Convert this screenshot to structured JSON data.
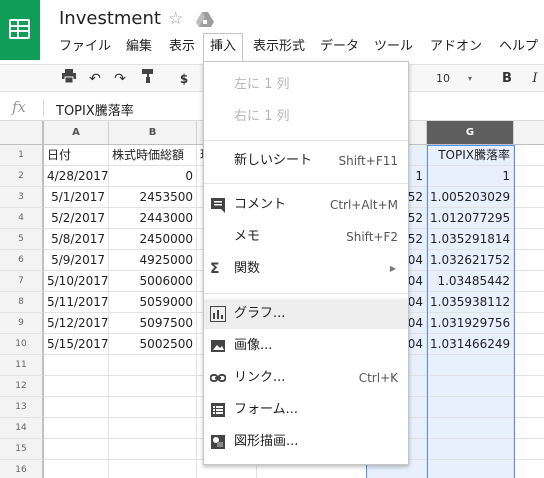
{
  "app": {
    "title": "Investment",
    "star_icon": "star-outline-icon",
    "drive_icon": "drive-icon"
  },
  "menubar": [
    {
      "label": "ファイル"
    },
    {
      "label": "編集"
    },
    {
      "label": "表示"
    },
    {
      "label": "挿入",
      "active": true
    },
    {
      "label": "表示形式"
    },
    {
      "label": "データ"
    },
    {
      "label": "ツール"
    },
    {
      "label": "アドオン"
    },
    {
      "label": "ヘルプ"
    }
  ],
  "toolbar": {
    "currency": "$",
    "font_size": "10",
    "bold": "B"
  },
  "formula": {
    "fx": "fx",
    "content": "TOPIX騰落率"
  },
  "grid": {
    "columns": [
      "A",
      "B",
      "",
      "",
      "",
      "",
      "G"
    ],
    "selected_column": "G",
    "row_numbers": [
      "1",
      "2",
      "3",
      "4",
      "5",
      "6",
      "7",
      "8",
      "9",
      "10",
      "11",
      "12",
      "13",
      "14",
      "15",
      "16"
    ],
    "col_a": [
      "日付",
      "4/28/2017",
      "5/1/2017",
      "5/2/2017",
      "5/8/2017",
      "5/9/2017",
      "5/10/2017",
      "5/11/2017",
      "5/12/2017",
      "5/15/2017"
    ],
    "col_b": [
      "株式時価総額",
      "0",
      "2453500",
      "2443000",
      "2450000",
      "4925000",
      "5006000",
      "5059000",
      "5097500",
      "5002500"
    ],
    "col_c": [
      "現"
    ],
    "col_f": [
      "",
      "1",
      "52",
      "52",
      "52",
      "04",
      "04",
      "04",
      "04",
      "04"
    ],
    "col_g": [
      "TOPIX騰落率",
      "1",
      "1.005203029",
      "1.012077295",
      "1.035291814",
      "1.032621752",
      "1.03485442",
      "1.035938112",
      "1.031929756",
      "1.031466249"
    ]
  },
  "insert_menu": {
    "items": [
      {
        "label": "左に 1 列",
        "disabled": true
      },
      {
        "label": "右に 1 列",
        "disabled": true
      },
      {
        "label": "新しいシート",
        "shortcut": "Shift+F11"
      },
      {
        "label": "コメント",
        "shortcut": "Ctrl+Alt+M",
        "icon": "comment-icon"
      },
      {
        "label": "メモ",
        "shortcut": "Shift+F2"
      },
      {
        "label": "関数",
        "icon": "sigma-icon",
        "submenu": true
      },
      {
        "label": "グラフ...",
        "icon": "chart-icon",
        "hover": true
      },
      {
        "label": "画像...",
        "icon": "image-icon"
      },
      {
        "label": "リンク...",
        "shortcut": "Ctrl+K",
        "icon": "link-icon"
      },
      {
        "label": "フォーム...",
        "icon": "form-icon"
      },
      {
        "label": "図形描画...",
        "icon": "drawing-icon"
      }
    ]
  },
  "colors": {
    "brand_green": "#0f9d58",
    "selection_blue": "#4d90fe",
    "selected_column_fill": "#e8f0fe"
  }
}
